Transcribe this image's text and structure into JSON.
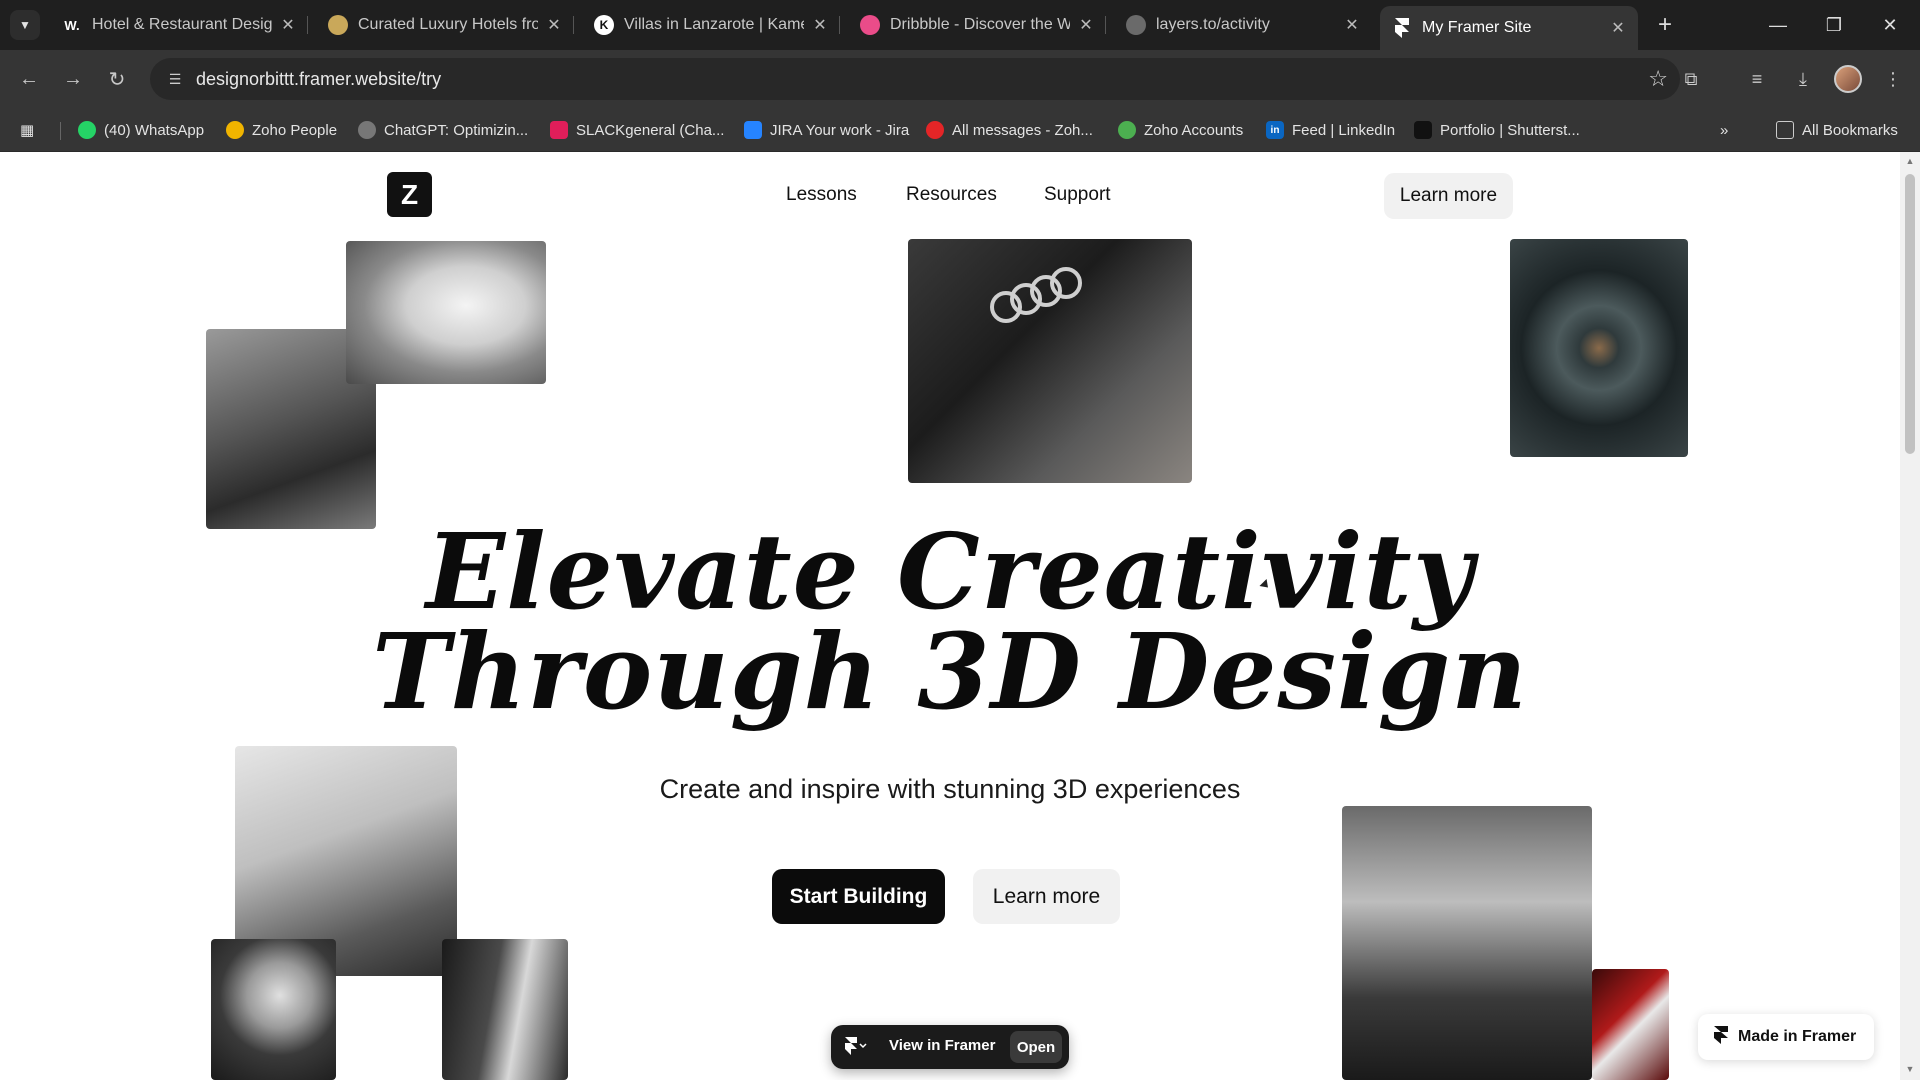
{
  "browser": {
    "tabs": [
      {
        "title": "Hotel & Restaurant Design",
        "favicon_letter": "W.",
        "favicon_color": "#2a2a2a"
      },
      {
        "title": "Curated Luxury Hotels from",
        "favicon_letter": "",
        "favicon_color": "#c9a85a"
      },
      {
        "title": "Villas in Lanzarote | Kameza",
        "favicon_letter": "K",
        "favicon_color": "#ffffff"
      },
      {
        "title": "Dribbble - Discover the Wo",
        "favicon_letter": "",
        "favicon_color": "#ea4c89"
      },
      {
        "title": "layers.to/activity",
        "favicon_letter": "",
        "favicon_color": "#8a8a8a"
      },
      {
        "title": "My Framer Site",
        "favicon_letter": "",
        "favicon_color": "#ffffff"
      }
    ],
    "address": "designorbittt.framer.website/try",
    "bookmarks": [
      {
        "label": "(40) WhatsApp",
        "color": "#25d366"
      },
      {
        "label": "Zoho People",
        "color": "#f0b400"
      },
      {
        "label": "ChatGPT: Optimizin...",
        "color": "#777777"
      },
      {
        "label": "SLACKgeneral (Cha...",
        "color": "#e01e5a"
      },
      {
        "label": "JIRA Your work - Jira",
        "color": "#2684ff"
      },
      {
        "label": "All messages - Zoh...",
        "color": "#e42527"
      },
      {
        "label": "Zoho Accounts",
        "color": "#4caf50"
      },
      {
        "label": "Feed | LinkedIn",
        "color": "#0a66c2"
      },
      {
        "label": "Portfolio | Shutterst...",
        "color": "#111111"
      }
    ],
    "all_bookmarks": "All Bookmarks"
  },
  "site": {
    "logo_letter": "Z",
    "nav": [
      "Lessons",
      "Resources",
      "Support"
    ],
    "nav_cta": "Learn more",
    "hero_line1": "Elevate Creativity",
    "hero_line2": "Through 3D Design",
    "subtitle": "Create and inspire with stunning 3D experiences",
    "primary_cta": "Start Building",
    "secondary_cta": "Learn more",
    "framer_bar_label": "View in Framer",
    "framer_bar_open": "Open",
    "made_in_framer": "Made in Framer"
  }
}
